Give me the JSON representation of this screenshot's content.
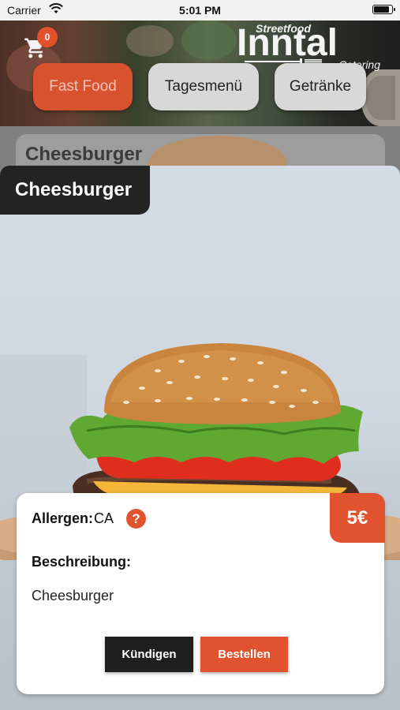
{
  "status_bar": {
    "carrier": "Carrier",
    "time": "5:01 PM",
    "icons": [
      "wifi-icon",
      "battery-icon"
    ]
  },
  "header": {
    "cart_icon": "cart-icon",
    "cart_count": "0",
    "logo": {
      "top": "Streetfood",
      "main": "Inntal",
      "sub": "Catering"
    },
    "tabs": [
      {
        "label": "Fast Food",
        "selected": true
      },
      {
        "label": "Tagesmenü",
        "selected": false
      },
      {
        "label": "Getränke",
        "selected": false
      }
    ]
  },
  "list": {
    "item_title": "Cheesburger"
  },
  "modal": {
    "title": "Cheesburger",
    "price": "5€",
    "allergen_label": "Allergen:",
    "allergen_value": "CA",
    "help_icon": "?",
    "description_label": "Beschreibung:",
    "description_value": "Cheesburger",
    "cancel_label": "Kündigen",
    "order_label": "Bestellen"
  },
  "colors": {
    "accent": "#e1522e",
    "dark": "#1f1f1f",
    "tab_inactive": "#d8d8d8"
  }
}
